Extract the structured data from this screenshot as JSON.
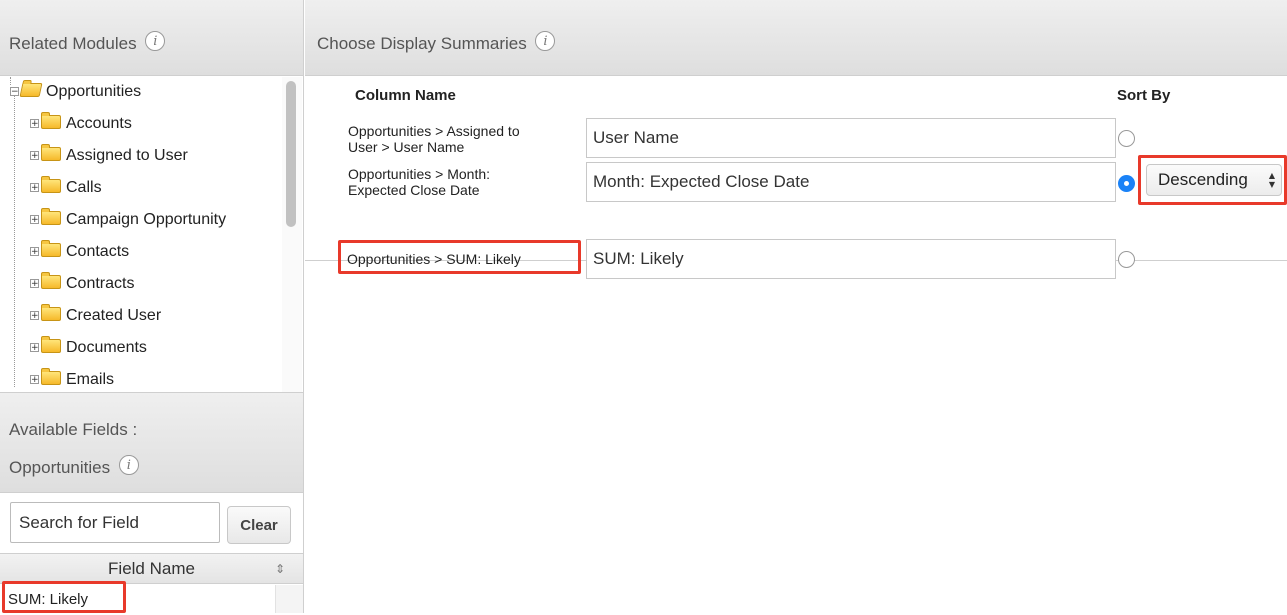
{
  "related_modules": {
    "title": "Related Modules",
    "tree": {
      "root": "Opportunities",
      "children": [
        "Accounts",
        "Assigned to User",
        "Calls",
        "Campaign Opportunity",
        "Contacts",
        "Contracts",
        "Created User",
        "Documents",
        "Emails"
      ]
    }
  },
  "available_fields": {
    "title_line1": "Available Fields :",
    "title_line2": "Opportunities",
    "search_placeholder": "Search for Field",
    "clear_label": "Clear",
    "column_header": "Field Name",
    "rows": [
      "SUM: Likely"
    ]
  },
  "display_summaries": {
    "title": "Choose Display Summaries",
    "column_name_header": "Column Name",
    "sort_by_header": "Sort By",
    "rows": [
      {
        "label_line1": "Opportunities > Assigned to",
        "label_line2": "User > User Name",
        "value": "User Name",
        "sort_selected": false
      },
      {
        "label_line1": "Opportunities > Month:",
        "label_line2": "Expected Close Date",
        "value": "Month: Expected Close Date",
        "sort_selected": true,
        "sort_order": "Descending"
      },
      {
        "label_line1": "Opportunities > SUM: Likely",
        "label_line2": "",
        "value": "SUM: Likely",
        "sort_selected": false
      }
    ]
  },
  "icons": {
    "info": "info-icon",
    "expand": "expand-icon",
    "collapse": "collapse-icon",
    "folder": "folder-icon"
  },
  "colors": {
    "highlight": "#e8392a",
    "radio_checked": "#1a82f7"
  }
}
